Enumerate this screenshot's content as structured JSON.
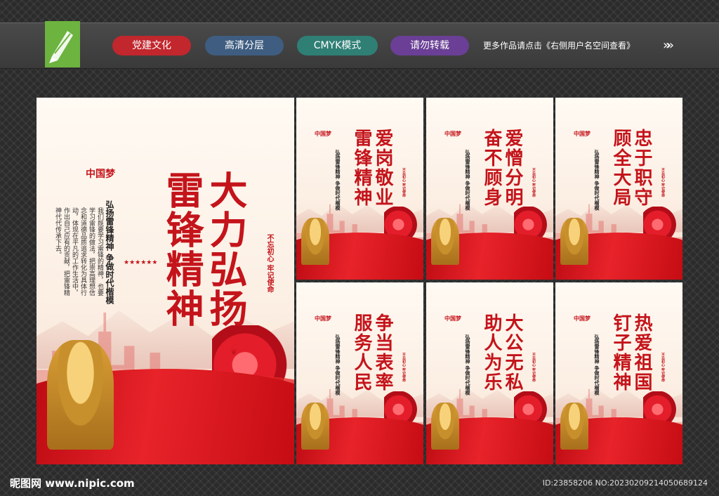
{
  "header": {
    "tags": [
      "党建文化",
      "高清分层",
      "CMYK模式",
      "请勿转载"
    ],
    "more_text": "更多作品请点击《右侧用户名空间查看》",
    "arrow_glyph": "»»"
  },
  "main_poster": {
    "logo_text": "中国梦",
    "title": "大力弘扬雷锋精神",
    "subtitle": "弘扬雷锋精神 争做时代楷模",
    "body": "我们既要学习雷锋的精神，也要学习雷锋的做法，把崇高理想信念和道德品质追求转化为具体行动，体现在平凡的工作生活中，作出自己应有的贡献，把雷锋精神代代传承下去。",
    "seal": "不忘初心 牢记使命",
    "stars": "★★★★★★"
  },
  "small_posters": [
    {
      "title": "爱岗敬业雷锋精神",
      "subtitle": "弘扬雷锋精神 争做时代楷模"
    },
    {
      "title": "爱憎分明奋不顾身",
      "subtitle": "弘扬雷锋精神 争做时代楷模"
    },
    {
      "title": "忠于职守顾全大局",
      "subtitle": "弘扬雷锋精神 争做时代楷模"
    },
    {
      "title": "争当表率服务人民",
      "subtitle": "弘扬雷锋精神 争做时代楷模"
    },
    {
      "title": "大公无私助人为乐",
      "subtitle": "弘扬雷锋精神 争做时代楷模"
    },
    {
      "title": "热爱祖国钉子精神",
      "subtitle": "弘扬雷锋精神 争做时代楷模"
    }
  ],
  "footer": {
    "watermark": "昵图网 www.nipic.com",
    "id_text": "ID:23858206 NO:20230209214050689124"
  },
  "colors": {
    "accent_red": "#c4141b",
    "logo_green": "#6cb33f"
  }
}
